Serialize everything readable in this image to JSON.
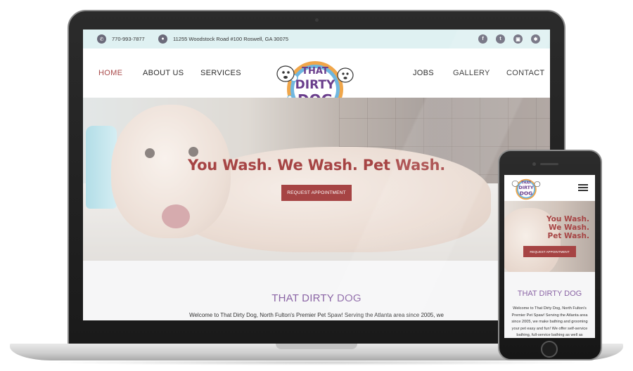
{
  "site": {
    "topbar": {
      "phone": "770-993-7877",
      "address": "11255 Woodstock Road #100 Roswell, GA 30075",
      "social_icons": [
        "facebook-icon",
        "twitter-icon",
        "instagram-icon",
        "yelp-icon"
      ]
    },
    "nav": {
      "left": [
        "HOME",
        "ABOUT US",
        "SERVICES"
      ],
      "right": [
        "JOBS",
        "GALLERY",
        "CONTACT"
      ],
      "active": "HOME"
    },
    "logo": {
      "line1": "THAT",
      "line2": "DIRTY",
      "line3": "DOG"
    },
    "hero": {
      "title": "You Wash. We Wash. Pet Wash.",
      "button": "REQUEST APPOINTMENT"
    },
    "content": {
      "title": "THAT DIRTY DOG",
      "text": "Welcome to That Dirty Dog, North Fulton's Premier Pet Spaw! Serving the Atlanta area since 2005, we"
    }
  },
  "mobile": {
    "hero": {
      "lines": [
        "You Wash.",
        "We Wash.",
        "Pet Wash."
      ],
      "button": "REQUEST APPOINTMENT"
    },
    "content": {
      "title": "THAT DIRTY DOG",
      "lines": [
        "Welcome to That Dirty Dog, North Fulton's",
        "Premier Pet Spaw! Serving the Atlanta area",
        "since 2005, we make bathing and grooming",
        "your pet easy and fun! We offer self-service",
        "bathing, full-service bathing as well as"
      ]
    }
  },
  "colors": {
    "accent_red": "#a64444",
    "title_purple": "#8a64a5",
    "topbar_bg": "#dff1f2",
    "icon_gray": "#6b6a7a"
  }
}
